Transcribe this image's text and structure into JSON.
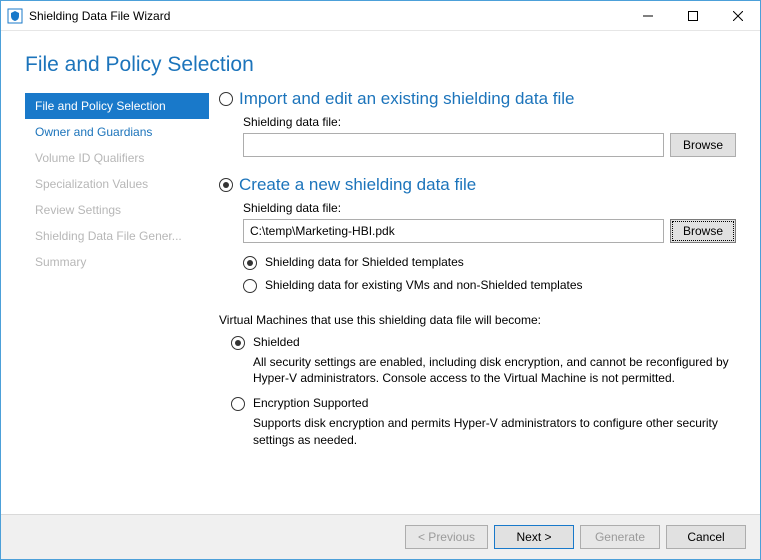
{
  "window": {
    "title": "Shielding Data File Wizard"
  },
  "header": {
    "title": "File and Policy Selection"
  },
  "sidebar": {
    "items": [
      {
        "label": "File and Policy Selection",
        "state": "active"
      },
      {
        "label": "Owner and Guardians",
        "state": "link"
      },
      {
        "label": "Volume ID Qualifiers",
        "state": "disabled"
      },
      {
        "label": "Specialization Values",
        "state": "disabled"
      },
      {
        "label": "Review Settings",
        "state": "disabled"
      },
      {
        "label": "Shielding Data File Gener...",
        "state": "disabled"
      },
      {
        "label": "Summary",
        "state": "disabled"
      }
    ]
  },
  "options": {
    "import": {
      "title": "Import and edit an existing shielding data file",
      "field_label": "Shielding data file:",
      "value": "",
      "browse": "Browse",
      "selected": false
    },
    "create": {
      "title": "Create a new shielding data file",
      "field_label": "Shielding data file:",
      "value": "C:\\temp\\Marketing-HBI.pdk",
      "browse": "Browse",
      "selected": true,
      "template_options": {
        "shielded_templates": {
          "label": "Shielding data for Shielded templates",
          "selected": true
        },
        "non_shielded_templates": {
          "label": "Shielding data for existing VMs and non-Shielded templates",
          "selected": false
        }
      },
      "vm_note": "Virtual Machines that use this shielding data file will become:",
      "vm_options": {
        "shielded": {
          "label": "Shielded",
          "desc": "All security settings are enabled, including disk encryption, and cannot be reconfigured by Hyper-V administrators. Console access to the Virtual Machine is not permitted.",
          "selected": true
        },
        "encryption_supported": {
          "label": "Encryption Supported",
          "desc": "Supports disk encryption and permits Hyper-V administrators to configure other security settings as needed.",
          "selected": false
        }
      }
    }
  },
  "footer": {
    "previous": "< Previous",
    "next": "Next >",
    "generate": "Generate",
    "cancel": "Cancel"
  }
}
